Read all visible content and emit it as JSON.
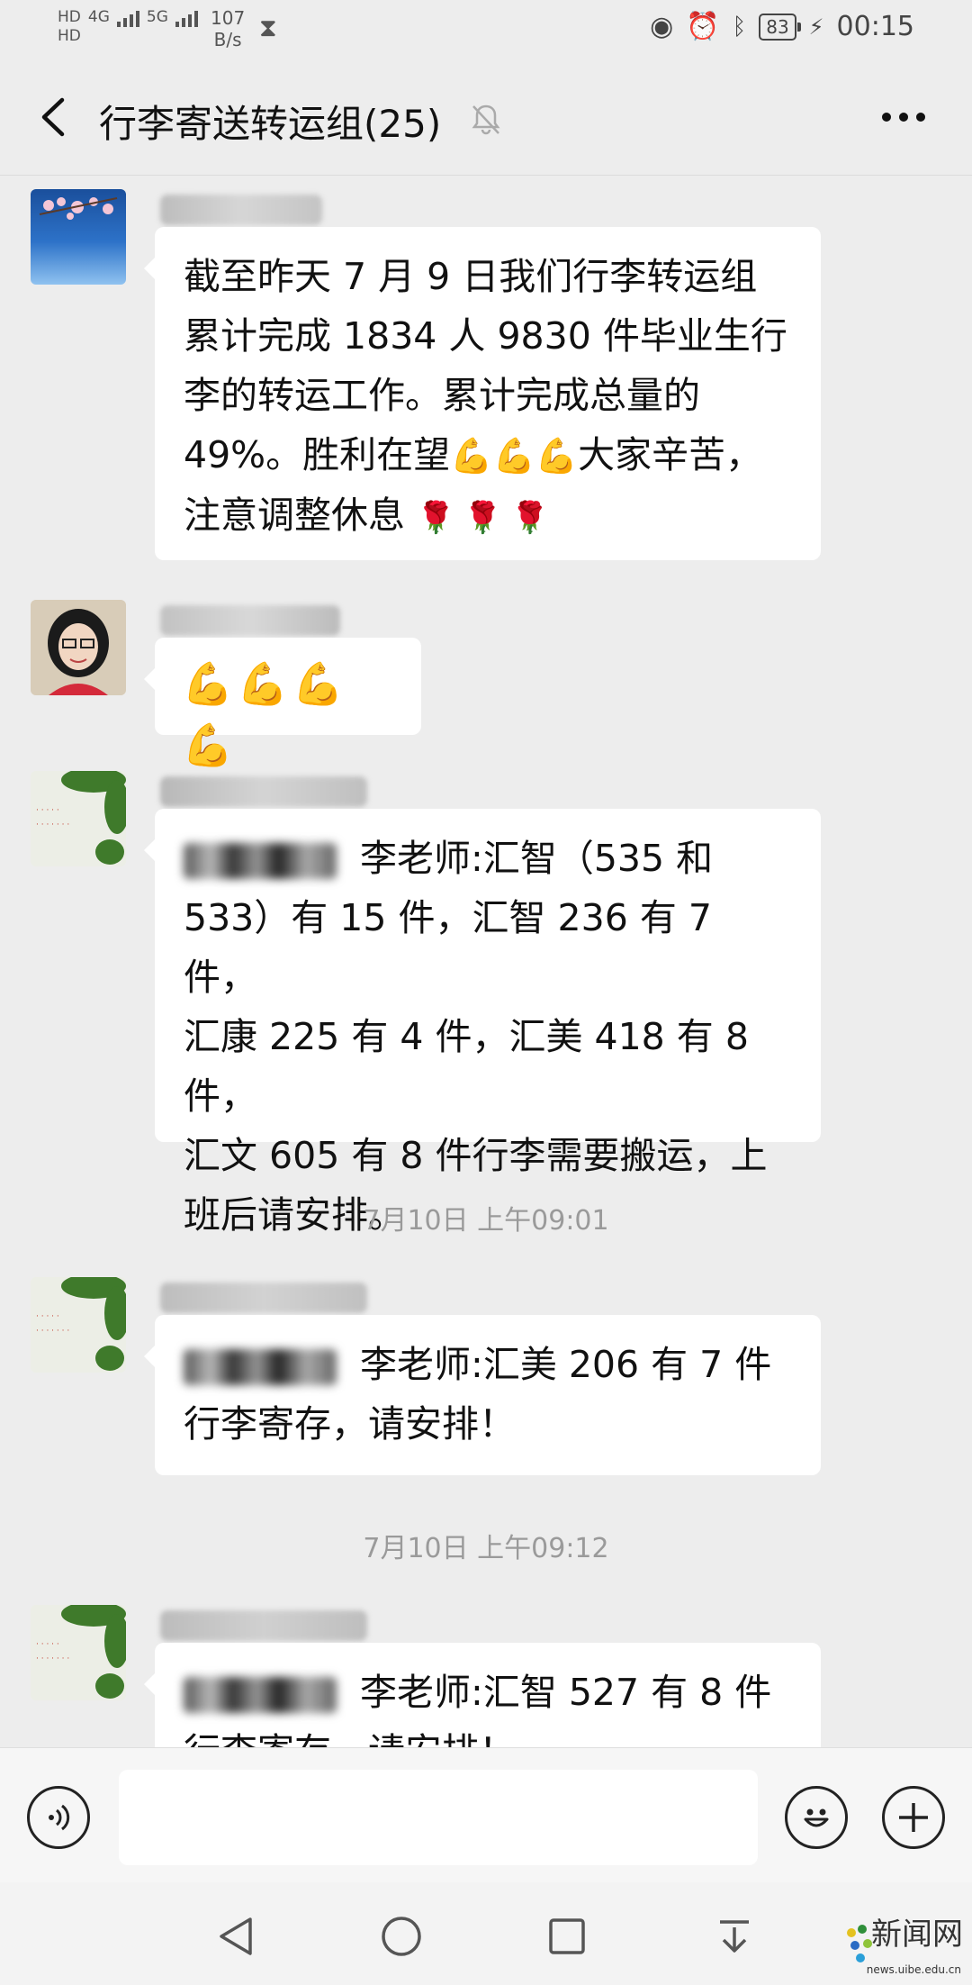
{
  "status_bar": {
    "hd1": "HD",
    "hd2": "HD",
    "network": "4G",
    "network2": "5G",
    "speed_value": "107",
    "speed_unit": "B/s",
    "battery": "83",
    "time": "00:15"
  },
  "header": {
    "title": "行李寄送转运组(25)"
  },
  "messages": [
    {
      "text_line1": "截至昨天 7 月 9 日我们行李转运组",
      "text_line2": "累计完成 1834 人 9830 件毕业生行",
      "text_line3": "李的转运工作。累计完成总量的",
      "text_line4_a": "49%。胜利在望",
      "text_line4_emoji": "💪💪💪",
      "text_line4_b": "大家辛苦，",
      "text_line5_a": "注意调整休息",
      "text_line5_emoji": "🌹🌹🌹"
    },
    {
      "emoji": "💪💪💪💪"
    },
    {
      "text_line1": "李老师:汇智（535 和",
      "text_line2": "533）有 15 件，汇智 236 有 7 件，",
      "text_line3": "汇康 225 有 4 件，汇美 418 有 8 件，",
      "text_line4": "汇文 605 有 8 件行李需要搬运，上",
      "text_line5": "班后请安排。"
    },
    {
      "text_line1": "李老师:汇美 206 有 7 件",
      "text_line2": "行李寄存，请安排！"
    },
    {
      "text_line1": "李老师:汇智 527 有 8 件",
      "text_line2": "行李寄存，请安排！"
    }
  ],
  "timestamps": [
    "7月10日 上午09:01",
    "7月10日 上午09:12"
  ],
  "watermark": {
    "name": "新闻网",
    "url": "news.uibe.edu.cn"
  }
}
